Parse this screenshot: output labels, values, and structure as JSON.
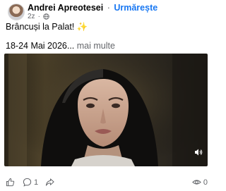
{
  "post": {
    "author": "Andrei Apreotesei",
    "separator": "·",
    "follow_label": "Urmărește",
    "time": "2z",
    "dot": "·",
    "line1": "Brâncuși la Palat! ✨",
    "line2_dates": "18-24 Mai 2026...",
    "line2_more": " mai multe"
  },
  "actions": {
    "comments_count": "1",
    "views_count": "0"
  },
  "icons": [
    "globe-icon",
    "sound-on-icon",
    "like-icon",
    "comment-icon",
    "share-icon",
    "views-icon"
  ]
}
